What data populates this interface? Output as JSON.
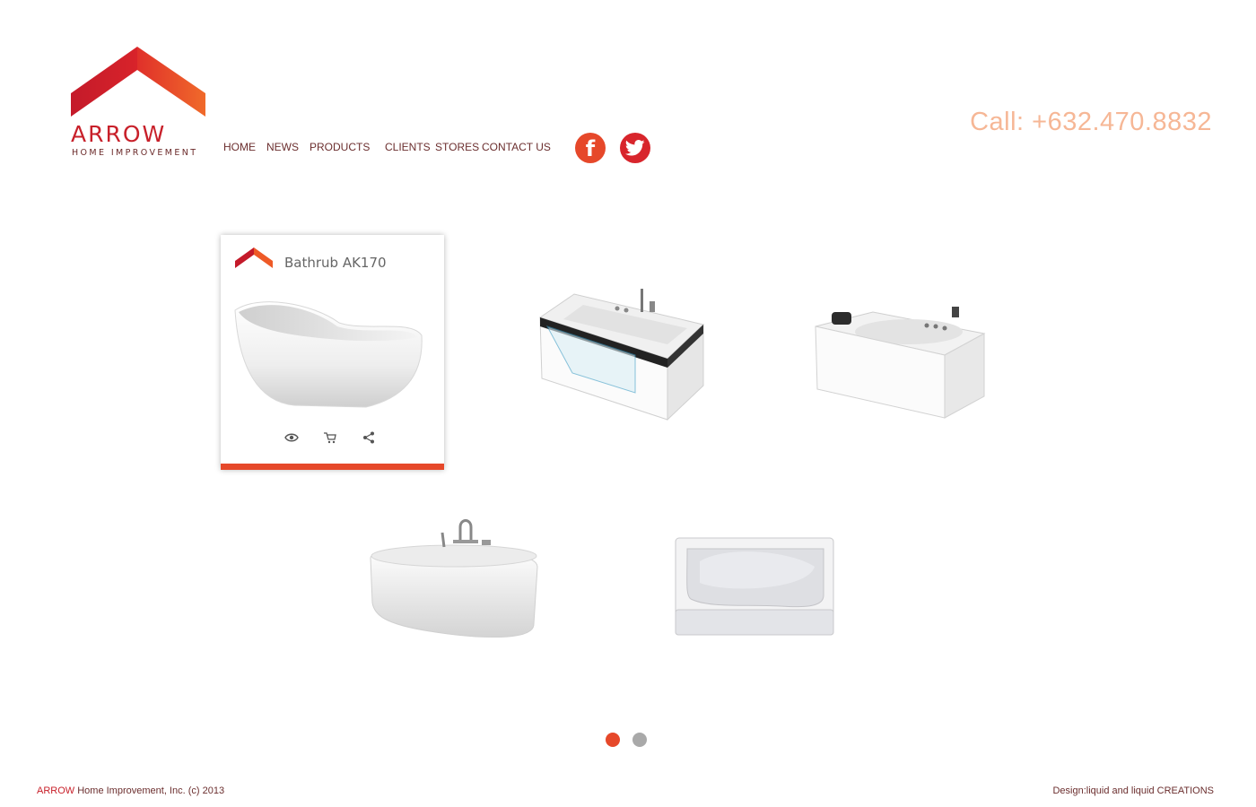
{
  "header": {
    "logo_word": "ARROW",
    "logo_sub": "HOME IMPROVEMENT",
    "nav": [
      "HOME",
      "NEWS",
      "PRODUCTS",
      "CLIENTS",
      "STORES",
      "CONTACT US"
    ],
    "social": [
      {
        "name": "facebook",
        "glyph": "f",
        "color": "#e6482a"
      },
      {
        "name": "twitter",
        "icon": "twitter-bird-icon",
        "color": "#d8252c"
      }
    ],
    "phone": "Call: +632.470.8832"
  },
  "product_card": {
    "title": "Bathrub AK170",
    "actions": [
      "view-icon",
      "cart-icon",
      "share-icon"
    ],
    "accent_color": "#e6482a"
  },
  "products": [
    {
      "name": "freestanding-slipper-tub",
      "in_card": true
    },
    {
      "name": "glass-panel-whirlpool-tub"
    },
    {
      "name": "jacuzzi-tub-with-headrest"
    },
    {
      "name": "oval-freestanding-tub"
    },
    {
      "name": "drop-in-soaking-tub"
    }
  ],
  "pagination": {
    "pages": 2,
    "active": 1,
    "active_color": "#e6482a",
    "inactive_color": "#a9a9a9"
  },
  "footer": {
    "brand": "ARROW",
    "copyright": " Home Improvement, Inc. (c) 2013",
    "credit": "Design:liquid and liquid CREATIONS"
  },
  "colors": {
    "brand_red": "#c8202a",
    "brand_orange": "#ef5a24",
    "nav_text": "#6b2e2e",
    "phone": "#f6b796"
  }
}
